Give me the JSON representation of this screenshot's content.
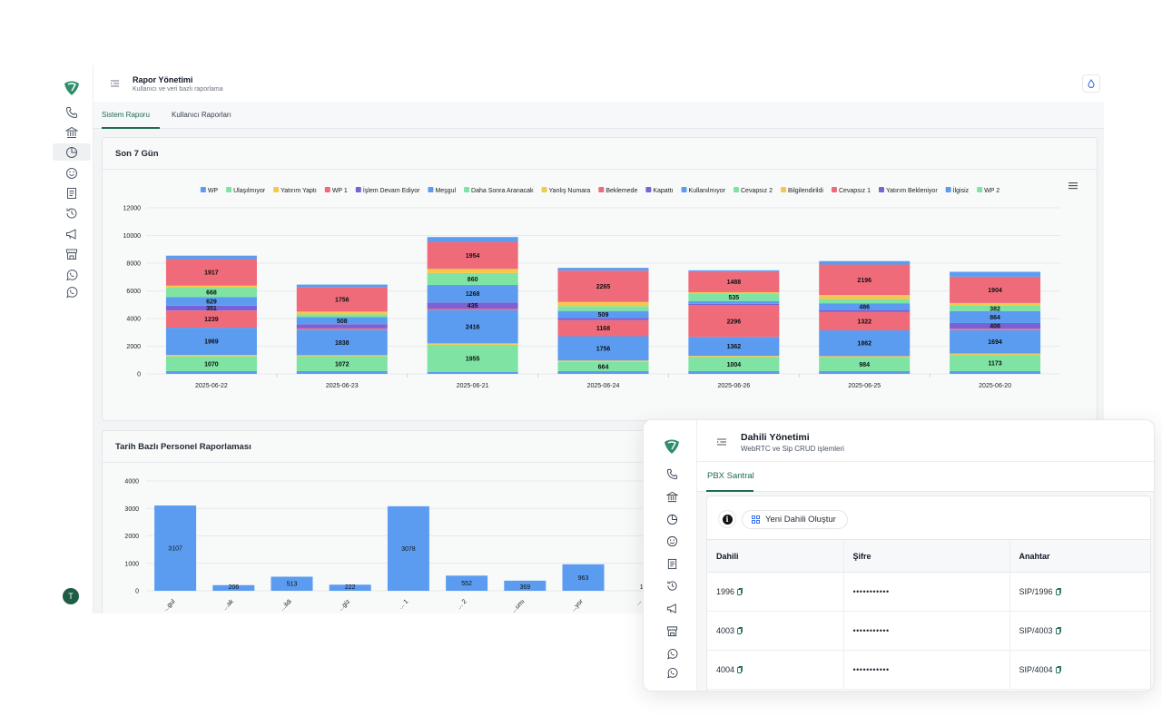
{
  "main": {
    "title": "Rapor Yönetimi",
    "subtitle": "Kullanıcı ve veri bazlı raporlama",
    "tabs": [
      {
        "label": "Sistem Raporu",
        "active": true
      },
      {
        "label": "Kullanıcı Raporları",
        "active": false
      }
    ],
    "avatar_letter": "T",
    "accent_color": "#1f6b4f",
    "sidebar_icons": [
      "phone-icon",
      "bank-icon",
      "pie-chart-icon",
      "smile-icon",
      "document-icon",
      "history-icon",
      "megaphone-icon",
      "store-icon",
      "whatsapp-icon",
      "whatsapp-icon"
    ],
    "header_buttons": [
      "drop-icon",
      "eye-icon"
    ]
  },
  "cards": {
    "weekly_title": "Son 7 Gün",
    "personnel_title": "Tarih Bazlı Personel Raporlaması"
  },
  "chart_data": [
    {
      "type": "bar",
      "stacked": true,
      "title": "Son 7 Gün",
      "categories": [
        "2025-06-22",
        "2025-06-23",
        "2025-06-21",
        "2025-06-24",
        "2025-06-26",
        "2025-06-25",
        "2025-06-20"
      ],
      "ylim": [
        0,
        12000
      ],
      "yticks": [
        0,
        2000,
        4000,
        6000,
        8000,
        10000,
        12000
      ],
      "grid": true,
      "legend_position": "top",
      "series": [
        {
          "name": "WP",
          "color": "#5b9cf1",
          "values": [
            200,
            200,
            150,
            200,
            200,
            200,
            200
          ],
          "labels": [
            false,
            false,
            false,
            false,
            false,
            false,
            false
          ]
        },
        {
          "name": "Ulaşılmıyor",
          "color": "#7ee3a3",
          "values": [
            1070,
            1072,
            1955,
            664,
            1004,
            984,
            1173
          ],
          "labels": [
            true,
            true,
            true,
            true,
            true,
            true,
            true
          ]
        },
        {
          "name": "Yatırım Yaptı",
          "color": "#f5c84c",
          "values": [
            100,
            80,
            100,
            100,
            100,
            100,
            100
          ],
          "labels": [
            false,
            false,
            false,
            false,
            false,
            false,
            false
          ]
        },
        {
          "name": "İlgisiz",
          "color": "#5b9cf1",
          "values": [
            1969,
            1838,
            2416,
            1756,
            1362,
            1862,
            1694
          ],
          "labels": [
            true,
            true,
            true,
            true,
            true,
            true,
            true
          ]
        },
        {
          "name": "WP 1",
          "color": "#ef6b7a",
          "values": [
            1239,
            100,
            100,
            1168,
            2296,
            1322,
            100
          ],
          "labels": [
            true,
            false,
            false,
            true,
            true,
            true,
            false
          ]
        },
        {
          "name": "İşlem Devam Ediyor",
          "color": "#7b61d6",
          "values": [
            351,
            300,
            435,
            150,
            100,
            150,
            408
          ],
          "labels": [
            true,
            false,
            true,
            false,
            false,
            false,
            true
          ]
        },
        {
          "name": "Meşgul",
          "color": "#5b9cf1",
          "values": [
            629,
            508,
            1268,
            509,
            200,
            486,
            864
          ],
          "labels": [
            true,
            true,
            true,
            true,
            false,
            true,
            true
          ]
        },
        {
          "name": "Daha Sonra Aranacak",
          "color": "#7ee3a3",
          "values": [
            668,
            200,
            860,
            350,
            535,
            300,
            382
          ],
          "labels": [
            true,
            false,
            true,
            false,
            true,
            false,
            true
          ]
        },
        {
          "name": "Yanlış Numara",
          "color": "#f5c84c",
          "values": [
            150,
            200,
            300,
            300,
            100,
            300,
            200
          ],
          "labels": [
            false,
            false,
            false,
            false,
            false,
            false,
            false
          ]
        },
        {
          "name": "Beklemede",
          "color": "#ef6b7a",
          "values": [
            1917,
            1756,
            1954,
            2265,
            1488,
            2196,
            1904
          ],
          "labels": [
            true,
            true,
            true,
            true,
            true,
            true,
            true
          ]
        },
        {
          "name": "Cevapsız 1",
          "color": "#5b9cf1",
          "values": [
            250,
            200,
            350,
            200,
            100,
            250,
            350
          ],
          "labels": [
            false,
            false,
            false,
            false,
            false,
            false,
            false
          ]
        }
      ],
      "legend": [
        {
          "name": "WP",
          "color": "#5b9cf1"
        },
        {
          "name": "Ulaşılmıyor",
          "color": "#7ee3a3"
        },
        {
          "name": "Yatırım Yaptı",
          "color": "#f5c84c"
        },
        {
          "name": "WP 1",
          "color": "#ef6b7a"
        },
        {
          "name": "İşlem Devam Ediyor",
          "color": "#7b61d6"
        },
        {
          "name": "Meşgul",
          "color": "#5b9cf1"
        },
        {
          "name": "Daha Sonra Aranacak",
          "color": "#7ee3a3"
        },
        {
          "name": "Yanlış Numara",
          "color": "#f5c84c"
        },
        {
          "name": "Beklemede",
          "color": "#ef6b7a"
        },
        {
          "name": "Kapattı",
          "color": "#7b61d6"
        },
        {
          "name": "Kullanılmıyor",
          "color": "#5b9cf1"
        },
        {
          "name": "Cevapsız 2",
          "color": "#7ee3a3"
        },
        {
          "name": "Bilgilendirildi",
          "color": "#f5c84c"
        },
        {
          "name": "Cevapsız 1",
          "color": "#ef6b7a"
        },
        {
          "name": "Yatırım Bekleniyor",
          "color": "#7b61d6"
        },
        {
          "name": "İlgisiz",
          "color": "#5b9cf1"
        },
        {
          "name": "WP 2",
          "color": "#7ee3a3"
        }
      ]
    },
    {
      "type": "bar",
      "title": "Tarih Bazlı Personel Raporlaması",
      "categories": [
        "...gul",
        "...ak",
        "...ildi",
        "...giz",
        "... 1",
        "... 2",
        "...umı",
        "...yor",
        "..."
      ],
      "values": [
        3107,
        206,
        513,
        222,
        3078,
        552,
        369,
        963,
        1
      ],
      "ylim": [
        0,
        4000
      ],
      "yticks": [
        0,
        1000,
        2000,
        3000,
        4000
      ],
      "color": "#5b9cf1"
    }
  ],
  "front": {
    "title": "Dahili Yönetimi",
    "subtitle": "WebRTC ve Sip CRUD işlemleri",
    "tab": "PBX Santral",
    "new_button": "Yeni Dahili Oluştur",
    "columns": [
      "Dahili",
      "Şifre",
      "Anahtar"
    ],
    "rows": [
      {
        "dahili": "1996",
        "sifre": "•••••••••••",
        "anahtar": "SIP/1996"
      },
      {
        "dahili": "4003",
        "sifre": "•••••••••••",
        "anahtar": "SIP/4003"
      },
      {
        "dahili": "4004",
        "sifre": "•••••••••••",
        "anahtar": "SIP/4004"
      }
    ]
  }
}
